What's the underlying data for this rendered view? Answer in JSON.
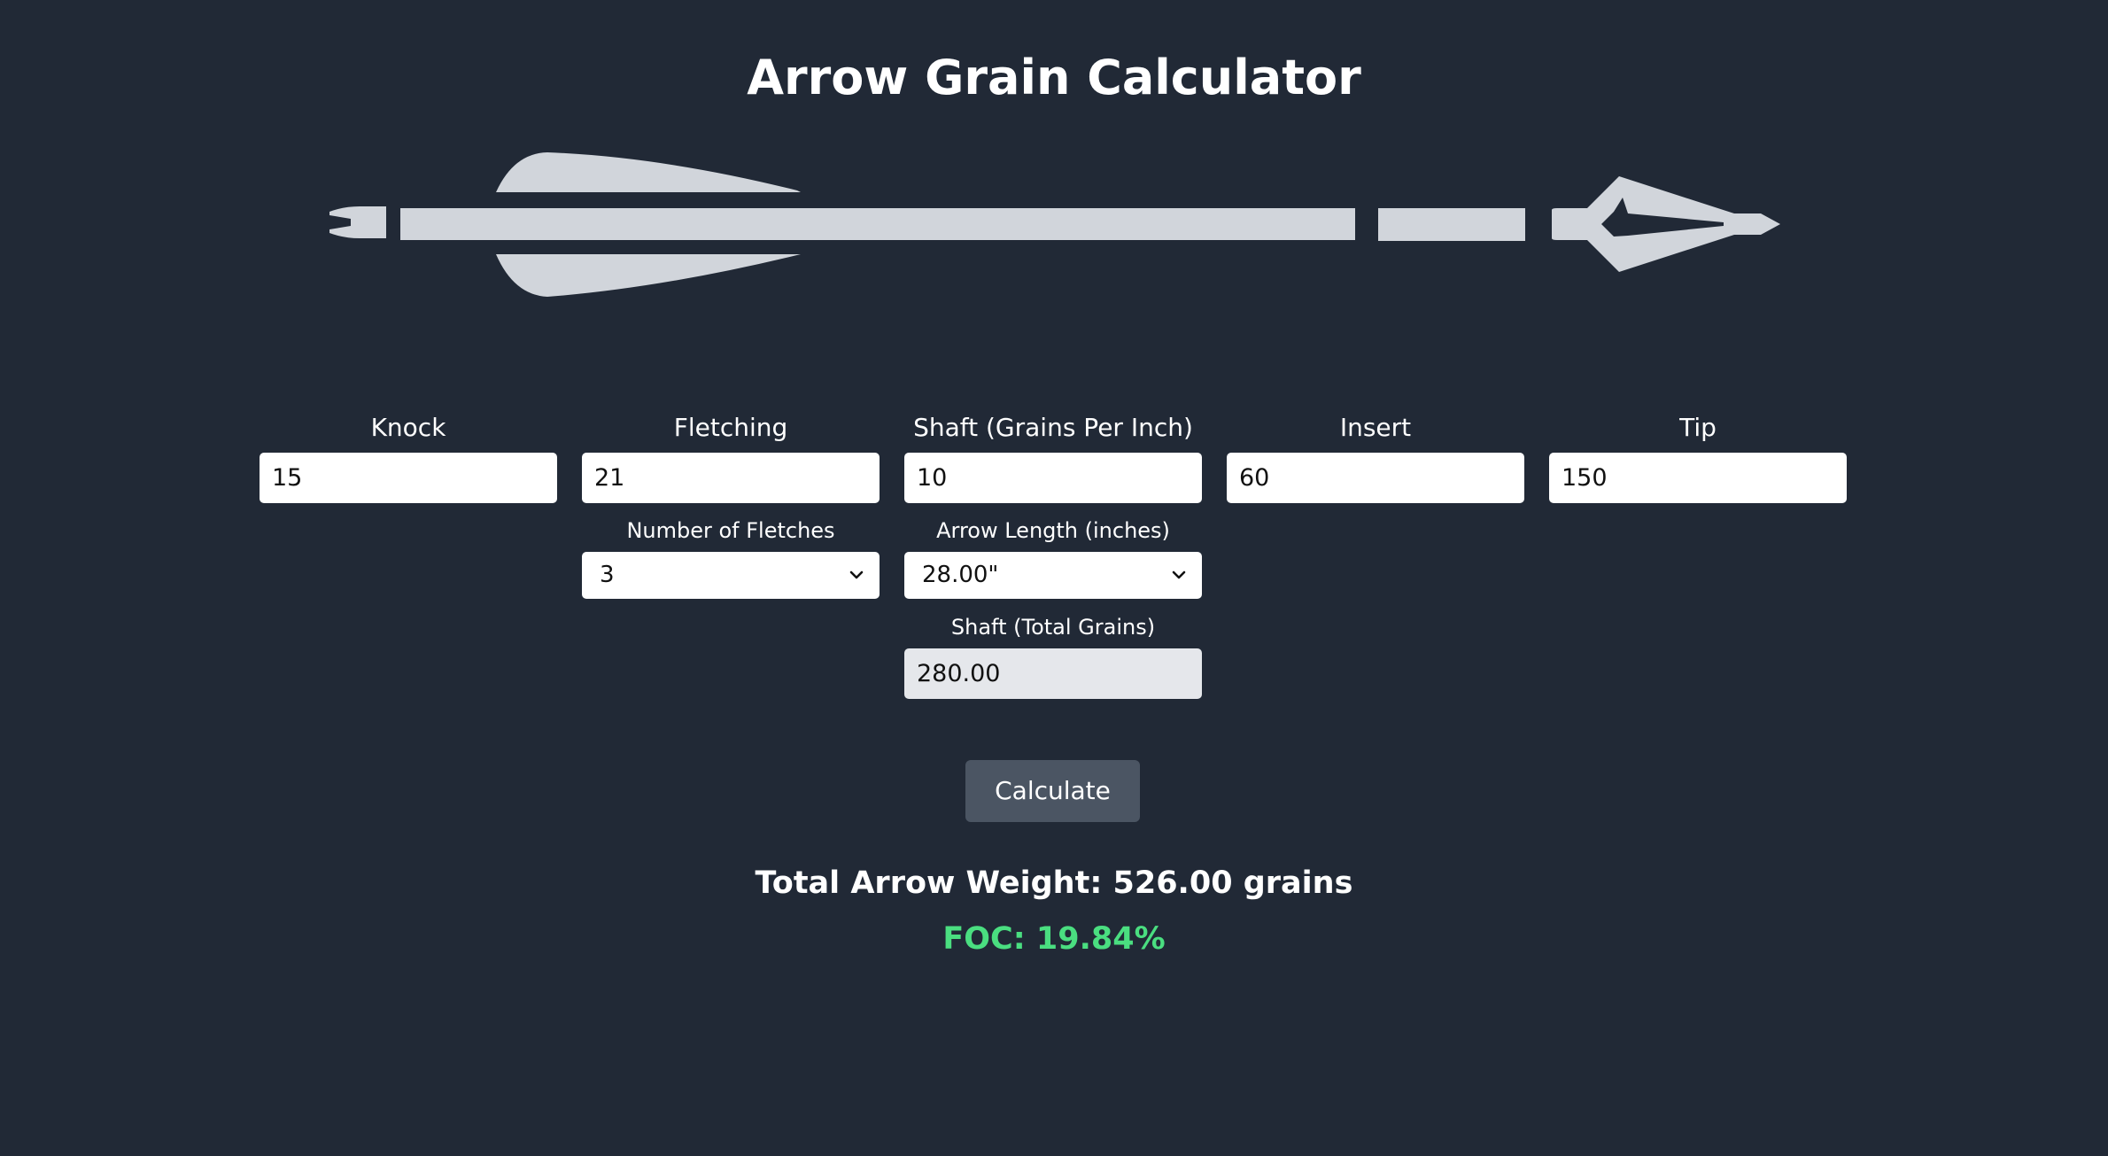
{
  "app": {
    "title": "Arrow Grain Calculator"
  },
  "illustration": {
    "icon": "arrow-icon",
    "color": "#d1d5db"
  },
  "fields": {
    "knock": {
      "label": "Knock",
      "value": "15"
    },
    "fletching": {
      "label": "Fletching",
      "value": "21"
    },
    "shaft_gpi": {
      "label": "Shaft (Grains Per Inch)",
      "value": "10"
    },
    "insert": {
      "label": "Insert",
      "value": "60"
    },
    "tip": {
      "label": "Tip",
      "value": "150"
    }
  },
  "selects": {
    "num_fletches": {
      "label": "Number of Fletches",
      "value": "3"
    },
    "arrow_length": {
      "label": "Arrow Length (inches)",
      "value": "28.00\""
    }
  },
  "shaft_total": {
    "label": "Shaft (Total Grains)",
    "value": "280.00"
  },
  "actions": {
    "calculate_label": "Calculate"
  },
  "results": {
    "total_weight": "Total Arrow Weight: 526.00 grains",
    "foc": "FOC: 19.84%"
  },
  "colors": {
    "background": "#212936",
    "button": "#4b5563",
    "foc_text": "#4ade80",
    "readonly_input": "#e5e7eb"
  }
}
